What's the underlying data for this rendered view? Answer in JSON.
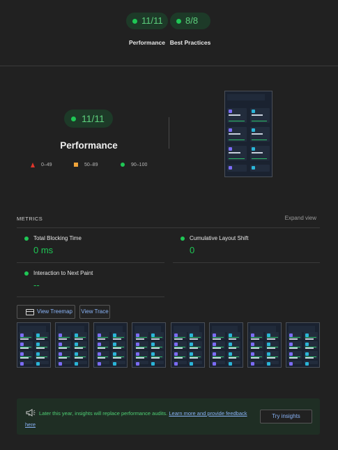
{
  "summary": {
    "gauges": [
      {
        "score": "11/11",
        "label": "Performance"
      },
      {
        "score": "8/8",
        "label": "Best Practices"
      }
    ]
  },
  "performance": {
    "score": "11/11",
    "title": "Performance",
    "legend": [
      {
        "shape": "triangle",
        "range": "0–49",
        "color": "#e0352b"
      },
      {
        "shape": "square",
        "range": "50–89",
        "color": "#f0a43a"
      },
      {
        "shape": "circle",
        "range": "90–100",
        "color": "#1fc755"
      }
    ]
  },
  "metrics": {
    "title": "METRICS",
    "expand_label": "Expand view",
    "items": [
      {
        "name": "Total Blocking Time",
        "value": "0 ms",
        "status": "pass"
      },
      {
        "name": "Cumulative Layout Shift",
        "value": "0",
        "status": "pass"
      },
      {
        "name": "Interaction to Next Paint",
        "value": "--",
        "status": "pass"
      }
    ]
  },
  "buttons": {
    "treemap": "View Treemap",
    "trace": "View Trace"
  },
  "filmstrip": {
    "frames": 8
  },
  "insights_banner": {
    "text": "Later this year, insights will replace performance audits.",
    "link": "Learn more and provide feedback here",
    "button": "Try insights",
    "icon": "megaphone-icon"
  },
  "colors": {
    "pass": "#1fc755",
    "average": "#f0a43a",
    "fail": "#e0352b",
    "link": "#8ab4f8",
    "background": "#212121"
  }
}
